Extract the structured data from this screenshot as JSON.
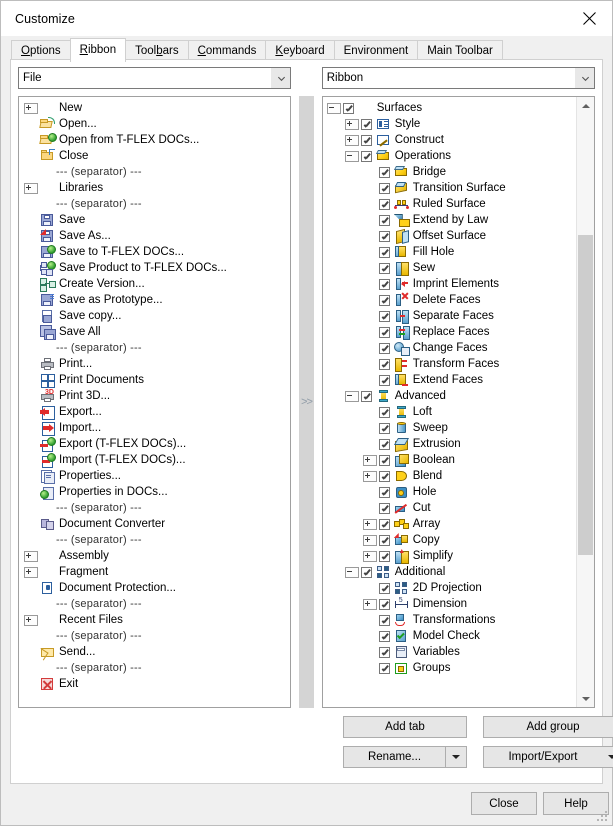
{
  "window": {
    "title": "Customize",
    "close_icon": "close-icon"
  },
  "tabs": [
    {
      "label": "Options",
      "accel": "O",
      "active": false
    },
    {
      "label": "Ribbon",
      "accel": "R",
      "active": true
    },
    {
      "label": "Toolbars",
      "accel": "b",
      "active": false
    },
    {
      "label": "Commands",
      "accel": "C",
      "active": false
    },
    {
      "label": "Keyboard",
      "accel": "K",
      "active": false
    },
    {
      "label": "Environment",
      "accel": "",
      "active": false
    },
    {
      "label": "Main Toolbar",
      "accel": "",
      "active": false
    }
  ],
  "left_combo": {
    "value": "File",
    "icon": "chevron-down-icon"
  },
  "right_combo": {
    "value": "Ribbon",
    "icon": "chevron-down-icon"
  },
  "transfer_button": {
    "label": ">>",
    "enabled": false
  },
  "left_tree": [
    {
      "label": "New",
      "indent": 0,
      "expander": "plus",
      "icon": "none"
    },
    {
      "label": "Open...",
      "indent": 0,
      "expander": "none",
      "icon": "folder-open-icon"
    },
    {
      "label": "Open from T-FLEX DOCs...",
      "indent": 0,
      "expander": "none",
      "icon": "folder-open-docs-icon"
    },
    {
      "label": "Close",
      "indent": 0,
      "expander": "none",
      "icon": "folder-close-icon"
    },
    {
      "label": "--- (separator) ---",
      "indent": 0,
      "expander": "none",
      "icon": "none",
      "separator": true
    },
    {
      "label": "Libraries",
      "indent": 0,
      "expander": "plus",
      "icon": "none"
    },
    {
      "label": "--- (separator) ---",
      "indent": 0,
      "expander": "none",
      "icon": "none",
      "separator": true
    },
    {
      "label": "Save",
      "indent": 0,
      "expander": "none",
      "icon": "save-icon"
    },
    {
      "label": "Save As...",
      "indent": 0,
      "expander": "none",
      "icon": "save-as-icon"
    },
    {
      "label": "Save to T-FLEX DOCs...",
      "indent": 0,
      "expander": "none",
      "icon": "save-docs-icon"
    },
    {
      "label": "Save Product to T-FLEX DOCs...",
      "indent": 0,
      "expander": "none",
      "icon": "save-product-docs-icon"
    },
    {
      "label": "Create Version...",
      "indent": 0,
      "expander": "none",
      "icon": "create-version-icon"
    },
    {
      "label": "Save as Prototype...",
      "indent": 0,
      "expander": "none",
      "icon": "save-prototype-icon"
    },
    {
      "label": "Save copy...",
      "indent": 0,
      "expander": "none",
      "icon": "save-copy-icon"
    },
    {
      "label": "Save All",
      "indent": 0,
      "expander": "none",
      "icon": "save-all-icon"
    },
    {
      "label": "--- (separator) ---",
      "indent": 0,
      "expander": "none",
      "icon": "none",
      "separator": true
    },
    {
      "label": "Print...",
      "indent": 0,
      "expander": "none",
      "icon": "printer-icon"
    },
    {
      "label": "Print Documents",
      "indent": 0,
      "expander": "none",
      "icon": "print-documents-icon"
    },
    {
      "label": "Print 3D...",
      "indent": 0,
      "expander": "none",
      "icon": "print-3d-icon"
    },
    {
      "label": "Export...",
      "indent": 0,
      "expander": "none",
      "icon": "export-icon"
    },
    {
      "label": "Import...",
      "indent": 0,
      "expander": "none",
      "icon": "import-icon"
    },
    {
      "label": "Export (T-FLEX DOCs)...",
      "indent": 0,
      "expander": "none",
      "icon": "export-docs-icon"
    },
    {
      "label": "Import (T-FLEX DOCs)...",
      "indent": 0,
      "expander": "none",
      "icon": "import-docs-icon"
    },
    {
      "label": "Properties...",
      "indent": 0,
      "expander": "none",
      "icon": "properties-icon"
    },
    {
      "label": "Properties in DOCs...",
      "indent": 0,
      "expander": "none",
      "icon": "properties-docs-icon"
    },
    {
      "label": "--- (separator) ---",
      "indent": 0,
      "expander": "none",
      "icon": "none",
      "separator": true
    },
    {
      "label": "Document Converter",
      "indent": 0,
      "expander": "none",
      "icon": "document-converter-icon"
    },
    {
      "label": "--- (separator) ---",
      "indent": 0,
      "expander": "none",
      "icon": "none",
      "separator": true
    },
    {
      "label": "Assembly",
      "indent": 0,
      "expander": "plus",
      "icon": "none"
    },
    {
      "label": "Fragment",
      "indent": 0,
      "expander": "plus",
      "icon": "none"
    },
    {
      "label": "Document Protection...",
      "indent": 0,
      "expander": "none",
      "icon": "document-protection-icon"
    },
    {
      "label": "--- (separator) ---",
      "indent": 0,
      "expander": "none",
      "icon": "none",
      "separator": true
    },
    {
      "label": "Recent Files",
      "indent": 0,
      "expander": "plus",
      "icon": "none"
    },
    {
      "label": "--- (separator) ---",
      "indent": 0,
      "expander": "none",
      "icon": "none",
      "separator": true
    },
    {
      "label": "Send...",
      "indent": 0,
      "expander": "none",
      "icon": "envelope-icon"
    },
    {
      "label": "--- (separator) ---",
      "indent": 0,
      "expander": "none",
      "icon": "none",
      "separator": true
    },
    {
      "label": "Exit",
      "indent": 0,
      "expander": "none",
      "icon": "exit-icon"
    }
  ],
  "right_tree": [
    {
      "label": "Surfaces",
      "indent": 0,
      "expander": "minus",
      "checked": true,
      "icon": "none"
    },
    {
      "label": "Style",
      "indent": 1,
      "expander": "plus",
      "checked": true,
      "icon": "style-icon"
    },
    {
      "label": "Construct",
      "indent": 1,
      "expander": "plus",
      "checked": true,
      "icon": "construct-icon"
    },
    {
      "label": "Operations",
      "indent": 1,
      "expander": "minus",
      "checked": true,
      "icon": "operations-icon"
    },
    {
      "label": "Bridge",
      "indent": 2,
      "expander": "none",
      "checked": true,
      "icon": "bridge-icon"
    },
    {
      "label": "Transition Surface",
      "indent": 2,
      "expander": "none",
      "checked": true,
      "icon": "transition-surface-icon"
    },
    {
      "label": "Ruled Surface",
      "indent": 2,
      "expander": "none",
      "checked": true,
      "icon": "ruled-surface-icon"
    },
    {
      "label": "Extend by Law",
      "indent": 2,
      "expander": "none",
      "checked": true,
      "icon": "extend-by-law-icon"
    },
    {
      "label": "Offset Surface",
      "indent": 2,
      "expander": "none",
      "checked": true,
      "icon": "offset-surface-icon"
    },
    {
      "label": "Fill Hole",
      "indent": 2,
      "expander": "none",
      "checked": true,
      "icon": "fill-hole-icon"
    },
    {
      "label": "Sew",
      "indent": 2,
      "expander": "none",
      "checked": true,
      "icon": "sew-icon"
    },
    {
      "label": "Imprint Elements",
      "indent": 2,
      "expander": "none",
      "checked": true,
      "icon": "imprint-elements-icon"
    },
    {
      "label": "Delete Faces",
      "indent": 2,
      "expander": "none",
      "checked": true,
      "icon": "delete-faces-icon"
    },
    {
      "label": "Separate Faces",
      "indent": 2,
      "expander": "none",
      "checked": true,
      "icon": "separate-faces-icon"
    },
    {
      "label": "Replace Faces",
      "indent": 2,
      "expander": "none",
      "checked": true,
      "icon": "replace-faces-icon"
    },
    {
      "label": "Change Faces",
      "indent": 2,
      "expander": "none",
      "checked": true,
      "icon": "change-faces-icon"
    },
    {
      "label": "Transform Faces",
      "indent": 2,
      "expander": "none",
      "checked": true,
      "icon": "transform-faces-icon"
    },
    {
      "label": "Extend Faces",
      "indent": 2,
      "expander": "none",
      "checked": true,
      "icon": "extend-faces-icon"
    },
    {
      "label": "Advanced",
      "indent": 1,
      "expander": "minus",
      "checked": true,
      "icon": "advanced-icon"
    },
    {
      "label": "Loft",
      "indent": 2,
      "expander": "none",
      "checked": true,
      "icon": "loft-icon"
    },
    {
      "label": "Sweep",
      "indent": 2,
      "expander": "none",
      "checked": true,
      "icon": "sweep-icon"
    },
    {
      "label": "Extrusion",
      "indent": 2,
      "expander": "none",
      "checked": true,
      "icon": "extrusion-icon"
    },
    {
      "label": "Boolean",
      "indent": 2,
      "expander": "plus",
      "checked": true,
      "icon": "boolean-icon"
    },
    {
      "label": "Blend",
      "indent": 2,
      "expander": "plus",
      "checked": true,
      "icon": "blend-icon"
    },
    {
      "label": "Hole",
      "indent": 2,
      "expander": "none",
      "checked": true,
      "icon": "hole-icon"
    },
    {
      "label": "Cut",
      "indent": 2,
      "expander": "none",
      "checked": true,
      "icon": "cut-icon"
    },
    {
      "label": "Array",
      "indent": 2,
      "expander": "plus",
      "checked": true,
      "icon": "array-icon"
    },
    {
      "label": "Copy",
      "indent": 2,
      "expander": "plus",
      "checked": true,
      "icon": "copy-icon"
    },
    {
      "label": "Simplify",
      "indent": 2,
      "expander": "plus",
      "checked": true,
      "icon": "simplify-icon"
    },
    {
      "label": "Additional",
      "indent": 1,
      "expander": "minus",
      "checked": true,
      "icon": "additional-icon"
    },
    {
      "label": "2D Projection",
      "indent": 2,
      "expander": "none",
      "checked": true,
      "icon": "2d-projection-icon"
    },
    {
      "label": "Dimension",
      "indent": 2,
      "expander": "plus",
      "checked": true,
      "icon": "dimension-icon"
    },
    {
      "label": "Transformations",
      "indent": 2,
      "expander": "none",
      "checked": true,
      "icon": "transformations-icon"
    },
    {
      "label": "Model Check",
      "indent": 2,
      "expander": "none",
      "checked": true,
      "icon": "model-check-icon"
    },
    {
      "label": "Variables",
      "indent": 2,
      "expander": "none",
      "checked": true,
      "icon": "variables-icon"
    },
    {
      "label": "Groups",
      "indent": 2,
      "expander": "none",
      "checked": true,
      "icon": "groups-icon"
    }
  ],
  "side_buttons": {
    "add_tab": "Add tab",
    "add_group": "Add group",
    "rename": "Rename...",
    "import_export": "Import/Export"
  },
  "footer_buttons": {
    "close": "Close",
    "help": "Help"
  },
  "scrollbar": {
    "up_icon": "chevron-up-icon",
    "down_icon": "chevron-down-icon"
  }
}
